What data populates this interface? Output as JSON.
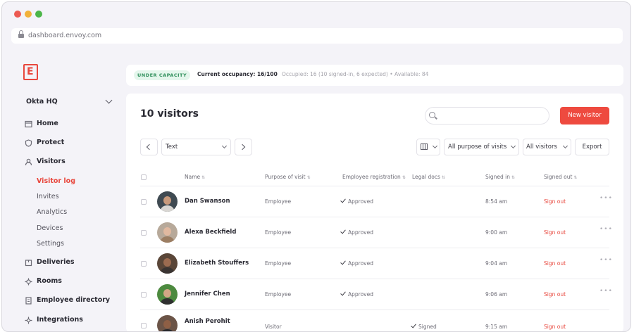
{
  "browser": {
    "url": "dashboard.envoy.com"
  },
  "brand": {
    "logo_letter": "E",
    "accent": "#e8473d"
  },
  "sidebar": {
    "location": "Okta HQ",
    "items": [
      {
        "label": "Home",
        "icon": "home-icon"
      },
      {
        "label": "Protect",
        "icon": "shield-icon"
      },
      {
        "label": "Visitors",
        "icon": "visitors-icon"
      },
      {
        "label": "Deliveries",
        "icon": "package-icon"
      },
      {
        "label": "Rooms",
        "icon": "rooms-icon"
      },
      {
        "label": "Employee directory",
        "icon": "directory-icon"
      },
      {
        "label": "Integrations",
        "icon": "integrations-icon"
      }
    ],
    "visitor_subitems": [
      "Visitor log",
      "Invites",
      "Analytics",
      "Devices",
      "Settings"
    ],
    "active_subitem": "Visitor log"
  },
  "capacity": {
    "badge": "UNDER CAPACITY",
    "occupancy": "Current occupancy: 16/100",
    "detail": "Occupied: 16 (10 signed-in, 6 expected) • Available: 84"
  },
  "main": {
    "title": "10 visitors",
    "new_button": "New visitor",
    "filter_text": "Text",
    "purpose_filter": "All purpose of visits",
    "visitors_filter": "All visitors",
    "export": "Export",
    "columns": [
      "Name",
      "Purpose of visit",
      "Employee registration",
      "Legal docs",
      "Signed in",
      "Signed out"
    ],
    "rows": [
      {
        "name": "Dan Swanson",
        "purpose": "Employee",
        "registration": "Approved",
        "legal": "",
        "signed_in": "8:54 am",
        "signed_out": "Sign out"
      },
      {
        "name": "Alexa Beckfield",
        "purpose": "Employee",
        "registration": "Approved",
        "legal": "",
        "signed_in": "9:00 am",
        "signed_out": "Sign out"
      },
      {
        "name": "Elizabeth Stouffers",
        "purpose": "Employee",
        "registration": "Approved",
        "legal": "",
        "signed_in": "9:04 am",
        "signed_out": "Sign out"
      },
      {
        "name": "Jennifer Chen",
        "purpose": "Employee",
        "registration": "Approved",
        "legal": "",
        "signed_in": "9:06 am",
        "signed_out": "Sign out"
      },
      {
        "name": "Anish Perohit",
        "purpose": "Visitor",
        "registration": "",
        "legal": "Signed",
        "signed_in": "9:15 am",
        "signed_out": "Sign out"
      }
    ]
  }
}
